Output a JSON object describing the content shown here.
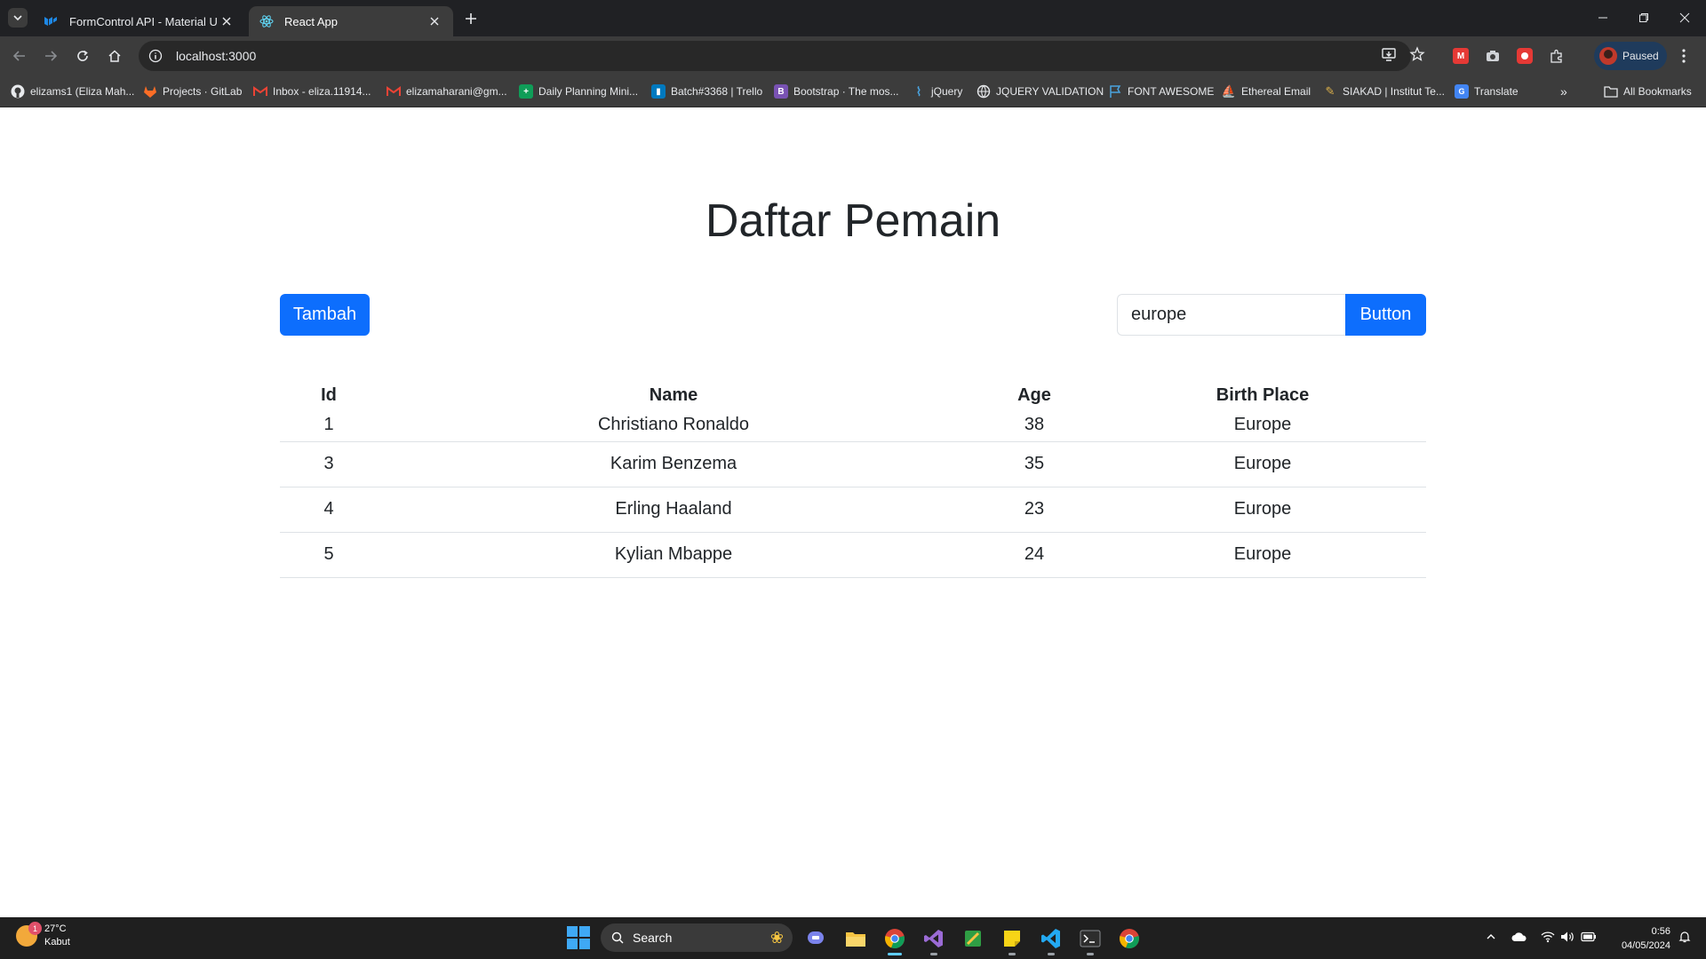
{
  "browser": {
    "tabs": [
      {
        "title": "FormControl API - Material UI",
        "active": false,
        "icon": "mui-logo-icon"
      },
      {
        "title": "React App",
        "active": true,
        "icon": "react-logo-icon"
      }
    ],
    "url": "localhost:3000",
    "profile_status": "Paused",
    "bookmarks": [
      {
        "label": "elizams1 (Eliza Mah...",
        "icon": "github-icon"
      },
      {
        "label": "Projects · GitLab",
        "icon": "gitlab-icon"
      },
      {
        "label": "Inbox - eliza.11914...",
        "icon": "gmail-icon"
      },
      {
        "label": "elizamaharani@gm...",
        "icon": "gmail-icon"
      },
      {
        "label": "Daily Planning Mini...",
        "icon": "sheets-icon"
      },
      {
        "label": "Batch#3368 | Trello",
        "icon": "trello-icon"
      },
      {
        "label": "Bootstrap · The mos...",
        "icon": "bootstrap-icon"
      },
      {
        "label": "jQuery",
        "icon": "jquery-icon"
      },
      {
        "label": "JQUERY VALIDATION",
        "icon": "globe-icon"
      },
      {
        "label": "FONT AWESOME",
        "icon": "flag-icon"
      },
      {
        "label": "Ethereal Email",
        "icon": "ethereal-icon"
      },
      {
        "label": "SIAKAD | Institut Te...",
        "icon": "siakad-icon"
      },
      {
        "label": "Translate",
        "icon": "translate-icon"
      }
    ],
    "all_bookmarks_label": "All Bookmarks"
  },
  "page": {
    "title": "Daftar Pemain",
    "add_button": "Tambah",
    "search": {
      "value": "europe",
      "button": "Button"
    },
    "table": {
      "headers": [
        "Id",
        "Name",
        "Age",
        "Birth Place"
      ],
      "rows": [
        {
          "id": "1",
          "name": "Christiano Ronaldo",
          "age": "38",
          "place": "Europe"
        },
        {
          "id": "3",
          "name": "Karim Benzema",
          "age": "35",
          "place": "Europe"
        },
        {
          "id": "4",
          "name": "Erling Haaland",
          "age": "23",
          "place": "Europe"
        },
        {
          "id": "5",
          "name": "Kylian Mbappe",
          "age": "24",
          "place": "Europe"
        }
      ]
    }
  },
  "taskbar": {
    "weather": {
      "temp": "27°C",
      "condition": "Kabut",
      "badge": "1"
    },
    "search_label": "Search",
    "time": "0:56",
    "date": "04/05/2024"
  },
  "colors": {
    "primary": "#0d6efd",
    "chrome_dark": "#202124",
    "chrome_toolbar": "#3c3c3c"
  }
}
